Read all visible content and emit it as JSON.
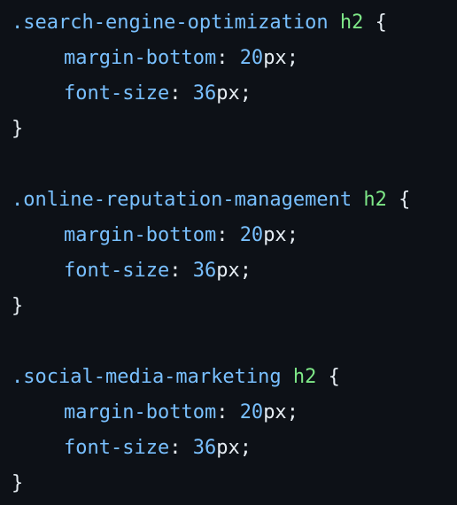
{
  "code": {
    "blocks": [
      {
        "selector": ".search-engine-optimization",
        "tag": "h2",
        "open": "{",
        "close": "}",
        "decls": [
          {
            "prop": "margin-bottom",
            "colon": ":",
            "num": "20",
            "unit": "px",
            "semi": ";"
          },
          {
            "prop": "font-size",
            "colon": ":",
            "num": "36",
            "unit": "px",
            "semi": ";"
          }
        ]
      },
      {
        "selector": ".online-reputation-management",
        "tag": "h2",
        "open": "{",
        "close": "}",
        "decls": [
          {
            "prop": "margin-bottom",
            "colon": ":",
            "num": "20",
            "unit": "px",
            "semi": ";"
          },
          {
            "prop": "font-size",
            "colon": ":",
            "num": "36",
            "unit": "px",
            "semi": ";"
          }
        ]
      },
      {
        "selector": ".social-media-marketing",
        "tag": "h2",
        "open": "{",
        "close": "}",
        "decls": [
          {
            "prop": "margin-bottom",
            "colon": ":",
            "num": "20",
            "unit": "px",
            "semi": ";"
          },
          {
            "prop": "font-size",
            "colon": ":",
            "num": "36",
            "unit": "px",
            "semi": ";"
          }
        ]
      }
    ]
  },
  "colors": {
    "background": "#0d1117",
    "selector": "#79c0ff",
    "tag": "#7ee787",
    "text": "#e6edf3"
  }
}
